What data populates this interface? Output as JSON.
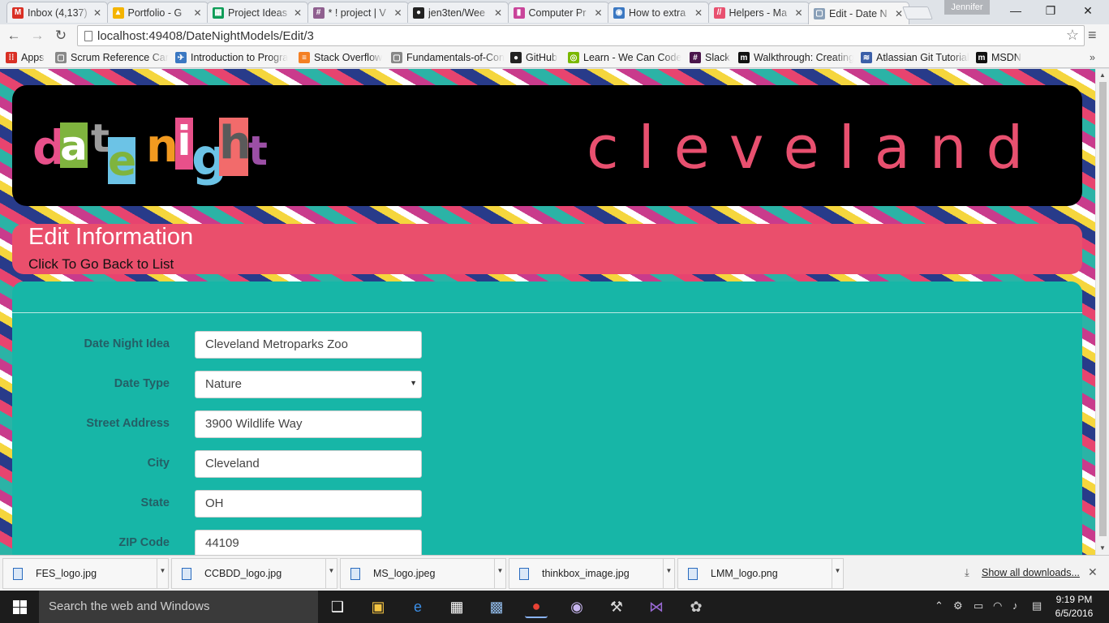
{
  "browser": {
    "tabs": [
      {
        "title": "Inbox (4,137)",
        "favicon": "gmail-icon",
        "color": "#d93025",
        "glyph": "M"
      },
      {
        "title": "Portfolio - G",
        "favicon": "google-drive-icon",
        "color": "#f4b400",
        "glyph": "▲"
      },
      {
        "title": "Project Ideas",
        "favicon": "google-sheets-icon",
        "color": "#0f9d58",
        "glyph": "▦"
      },
      {
        "title": "* ! project | V",
        "favicon": "slack-icon",
        "color": "#8f5f8f",
        "glyph": "#"
      },
      {
        "title": "jen3ten/Wee",
        "favicon": "github-icon",
        "color": "#222222",
        "glyph": "●"
      },
      {
        "title": "Computer Pr",
        "favicon": "trello-icon",
        "color": "#c9449a",
        "glyph": "▮"
      },
      {
        "title": "How to extra",
        "favicon": "web-icon",
        "color": "#3b78c2",
        "glyph": "◉"
      },
      {
        "title": "Helpers - Ma",
        "favicon": "helpers-icon",
        "color": "#e8506f",
        "glyph": "//"
      },
      {
        "title": "Edit - Date N",
        "favicon": "page-icon",
        "color": "#8aa0b8",
        "glyph": "▢",
        "active": true
      }
    ],
    "profile_name": "Jennifer",
    "url": "localhost:49408/DateNightModels/Edit/3",
    "bookmarks": [
      {
        "label": "Apps",
        "icon": "apps-grid-icon",
        "color": "#d93025",
        "glyph": "⁞⁞"
      },
      {
        "label": "Scrum Reference Card",
        "icon": "page-icon",
        "color": "#888888",
        "glyph": "▢"
      },
      {
        "label": "Introduction to Progra",
        "icon": "bird-icon",
        "color": "#3b78c2",
        "glyph": "✈"
      },
      {
        "label": "Stack Overflow",
        "icon": "stackoverflow-icon",
        "color": "#f48024",
        "glyph": "≡"
      },
      {
        "label": "Fundamentals-of-Con",
        "icon": "page-icon",
        "color": "#888888",
        "glyph": "▢"
      },
      {
        "label": "GitHub",
        "icon": "github-icon",
        "color": "#222222",
        "glyph": "●"
      },
      {
        "label": "Learn - We Can Code",
        "icon": "wecancode-icon",
        "color": "#7ab800",
        "glyph": "◎"
      },
      {
        "label": "Slack",
        "icon": "slack-icon",
        "color": "#4a154b",
        "glyph": "#"
      },
      {
        "label": "Walkthrough: Creating",
        "icon": "msdn-icon",
        "color": "#111111",
        "glyph": "m"
      },
      {
        "label": "Atlassian Git Tutorial",
        "icon": "atlassian-icon",
        "color": "#3b5fa8",
        "glyph": "≋"
      },
      {
        "label": "MSDN",
        "icon": "msdn-icon",
        "color": "#111111",
        "glyph": "m"
      }
    ]
  },
  "site": {
    "logo_letters": [
      "d",
      "a",
      "t",
      "e",
      "n",
      "i",
      "g",
      "h",
      "t"
    ],
    "city": "cleveland",
    "colors": {
      "pink": "#ea4f6c",
      "teal": "#17b6a7",
      "label": "#245f66"
    }
  },
  "page": {
    "heading": "Edit Information",
    "back_link": "Click To Go Back to List",
    "fields": [
      {
        "label": "Date Night Idea",
        "value": "Cleveland Metroparks Zoo",
        "type": "text"
      },
      {
        "label": "Date Type",
        "value": "Nature",
        "type": "select"
      },
      {
        "label": "Street Address",
        "value": "3900 Wildlife Way",
        "type": "text"
      },
      {
        "label": "City",
        "value": "Cleveland",
        "type": "text"
      },
      {
        "label": "State",
        "value": "OH",
        "type": "text"
      },
      {
        "label": "ZIP Code",
        "value": "44109",
        "type": "text"
      }
    ]
  },
  "downloads": {
    "files": [
      "FES_logo.jpg",
      "CCBDD_logo.jpg",
      "MS_logo.jpeg",
      "thinkbox_image.jpg",
      "LMM_logo.png"
    ],
    "show_all": "Show all downloads..."
  },
  "taskbar": {
    "search_placeholder": "Search the web and Windows",
    "time": "9:19 PM",
    "date": "6/5/2016"
  }
}
